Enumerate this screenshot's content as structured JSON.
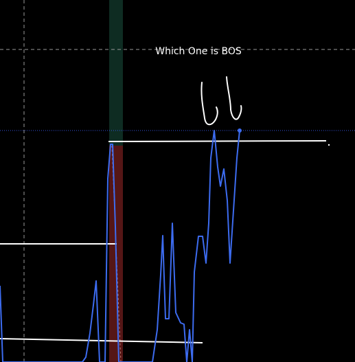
{
  "chart_data": {
    "type": "line",
    "annotation": "Which One is BOS",
    "colors": {
      "background": "#000000",
      "price_line": "#3d6cf0",
      "level_line": "#ffffff",
      "current_price_line": "#3355dd",
      "crosshair": "#9a9a9a",
      "green_zone": "#0f2e24",
      "red_zone": "#5a1717",
      "marker": "#3d6cf0",
      "handwriting": "#ffffff"
    },
    "series": [
      {
        "values": [
          [
            0,
            416
          ],
          [
            4,
            527
          ],
          [
            120,
            527
          ],
          [
            125,
            520
          ],
          [
            131,
            485
          ],
          [
            136,
            444
          ],
          [
            140,
            409
          ],
          [
            145,
            527
          ],
          [
            153,
            527
          ],
          [
            157,
            260
          ],
          [
            161,
            210
          ],
          [
            164,
            210
          ],
          [
            168,
            330
          ],
          [
            173,
            527
          ],
          [
            222,
            527
          ],
          [
            229,
            480
          ],
          [
            234,
            400
          ],
          [
            237,
            343
          ],
          [
            241,
            464
          ],
          [
            246,
            464
          ],
          [
            251,
            325
          ],
          [
            256,
            455
          ],
          [
            263,
            470
          ],
          [
            268,
            472
          ],
          [
            272,
            527
          ],
          [
            276,
            480
          ],
          [
            280,
            527
          ],
          [
            283,
            396
          ],
          [
            289,
            344
          ],
          [
            295,
            344
          ],
          [
            300,
            383
          ],
          [
            304,
            325
          ],
          [
            307,
            230
          ],
          [
            312,
            190
          ],
          [
            317,
            243
          ],
          [
            321,
            271
          ],
          [
            326,
            246
          ],
          [
            331,
            292
          ],
          [
            335,
            383
          ],
          [
            345,
            230
          ],
          [
            349,
            190
          ]
        ]
      }
    ],
    "levels": [
      {
        "x1": 0,
        "y1": 355,
        "x2": 170,
        "y2": 355
      },
      {
        "x1": 0,
        "y1": 493,
        "x2": 295,
        "y2": 499
      },
      {
        "x1": 158,
        "y1": 206,
        "x2": 475,
        "y2": 205
      }
    ],
    "current_price": 190,
    "crosshair": {
      "x": 35,
      "y": 72
    },
    "zones": [
      {
        "kind": "green",
        "x1": 159,
        "x2": 179,
        "y1": 0,
        "y2": 212
      },
      {
        "kind": "red",
        "x1": 159,
        "x2": 179,
        "y1": 212,
        "y2": 527
      }
    ]
  }
}
